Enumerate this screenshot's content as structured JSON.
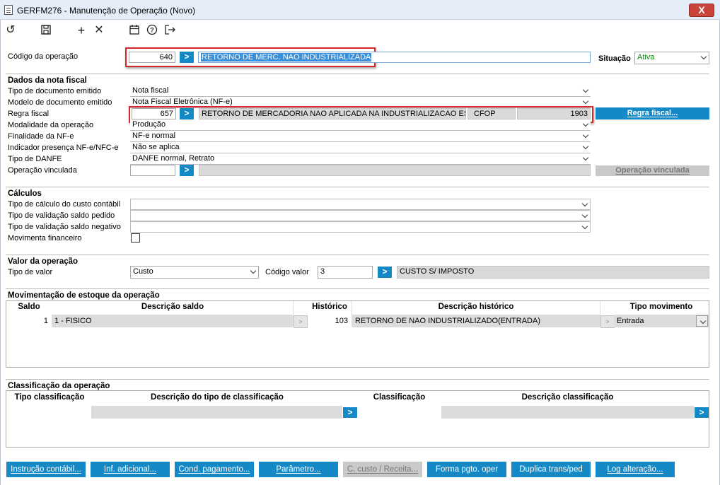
{
  "window": {
    "title": "GERFM276 - Manutenção de Operação (Novo)",
    "close_label": "X"
  },
  "toolbar": {
    "icons": [
      "undo-icon",
      "save-icon",
      "add-icon",
      "delete-icon",
      "calendar-icon",
      "help-icon",
      "exit-icon"
    ]
  },
  "header": {
    "codigo_label": "Código da operação",
    "codigo_value": "640",
    "codigo_go": ">",
    "descricao_value": "RETORNO DE MERC. NAO INDUSTRIALIZADA",
    "situacao_label": "Situação",
    "situacao_value": "Ativa"
  },
  "nota_fiscal": {
    "title": "Dados da nota fiscal",
    "tipo_doc_label": "Tipo de documento emitido",
    "tipo_doc_value": "Nota fiscal",
    "modelo_label": "Modelo de documento emitido",
    "modelo_value": "Nota Fiscal Eletrônica (NF-e)",
    "regra_label": "Regra fiscal",
    "regra_code": "657",
    "regra_go": ">",
    "regra_desc": "RETORNO DE MERCADORIA NAO APLICADA NA INDUSTRIALIZACAO ESTAD",
    "cfop_label": "CFOP",
    "cfop_value": "1903",
    "regra_button": "Regra fiscal...",
    "modalidade_label": "Modalidade da operação",
    "modalidade_value": "Produção",
    "finalidade_label": "Finalidade da NF-e",
    "finalidade_value": "NF-e normal",
    "presenca_label": "Indicador presença NF-e/NFC-e",
    "presenca_value": "Não se aplica",
    "danfe_label": "Tipo de DANFE",
    "danfe_value": "DANFE normal, Retrato",
    "vinculada_label": "Operação vinculada",
    "vinculada_value": "",
    "vinculada_go": ">",
    "vinculada_button": "Operação vinculada"
  },
  "calculos": {
    "title": "Cálculos",
    "custo_label": "Tipo de cálculo do custo contábil",
    "saldo_pedido_label": "Tipo de validação saldo pedido",
    "saldo_negativo_label": "Tipo de validação saldo negativo",
    "financeiro_label": "Movimenta financeiro",
    "financeiro_checked": false
  },
  "valor": {
    "title": "Valor da operação",
    "tipo_label": "Tipo de valor",
    "tipo_value": "Custo",
    "codigo_label": "Código valor",
    "codigo_value": "3",
    "codigo_go": ">",
    "descricao_value": "CUSTO S/ IMPOSTO"
  },
  "estoque": {
    "title": "Movimentação de estoque da operação",
    "columns": [
      "Saldo",
      "Descrição saldo",
      "Histórico",
      "Descrição histórico",
      "Tipo movimento"
    ],
    "rows": [
      {
        "saldo": "1",
        "descricao_saldo": "1 - FISICO",
        "btn1": ">",
        "historico": "103",
        "descricao_historico": "RETORNO DE NAO INDUSTRIALIZADO(ENTRADA)",
        "btn2": ">",
        "tipo_movimento": "Entrada"
      }
    ]
  },
  "classificacao": {
    "title": "Classificação da operação",
    "columns": [
      "Tipo classificação",
      "Descrição do tipo de classificação",
      "Classificação",
      "Descrição classificação"
    ],
    "btn": ">"
  },
  "footer_buttons": [
    {
      "label": "Instrução contábil...",
      "enabled": true
    },
    {
      "label": "Inf. adicional...",
      "enabled": true
    },
    {
      "label": "Cond. pagamento...",
      "enabled": true
    },
    {
      "label": "Parâmetro...",
      "enabled": true
    },
    {
      "label": "C. custo / Receita...",
      "enabled": false
    },
    {
      "label": "Forma pgto. oper",
      "enabled": true
    },
    {
      "label": "Duplica trans/ped",
      "enabled": true
    },
    {
      "label": "Log alteração...",
      "enabled": true
    }
  ],
  "colors": {
    "accent": "#1589c6",
    "highlight": "#d9262b",
    "status_green": "#0a8a0a",
    "selection": "#3a8fd8"
  }
}
